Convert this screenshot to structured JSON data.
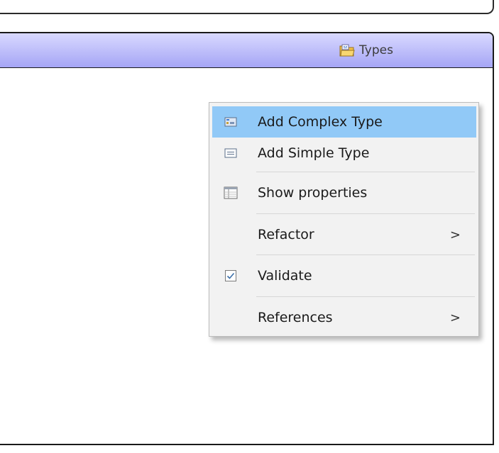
{
  "panel": {
    "title": "Types",
    "icon": "types-folder-icon",
    "header_colors": [
      "#d9d9ff",
      "#a5a5f5"
    ]
  },
  "context_menu": {
    "items": [
      {
        "label": "Add Complex Type",
        "icon": "complex-type-icon",
        "highlighted": true,
        "submenu": false
      },
      {
        "label": "Add Simple Type",
        "icon": "simple-type-icon",
        "highlighted": false,
        "submenu": false
      },
      {
        "label": "Show properties",
        "icon": "properties-table-icon",
        "highlighted": false,
        "submenu": false
      },
      {
        "label": "Refactor",
        "icon": "",
        "highlighted": false,
        "submenu": true,
        "arrow": ">"
      },
      {
        "label": "Validate",
        "icon": "checkbox-checked-icon",
        "highlighted": false,
        "submenu": false
      },
      {
        "label": "References",
        "icon": "",
        "highlighted": false,
        "submenu": true,
        "arrow": ">"
      }
    ],
    "highlight_color": "#91c9f7"
  }
}
